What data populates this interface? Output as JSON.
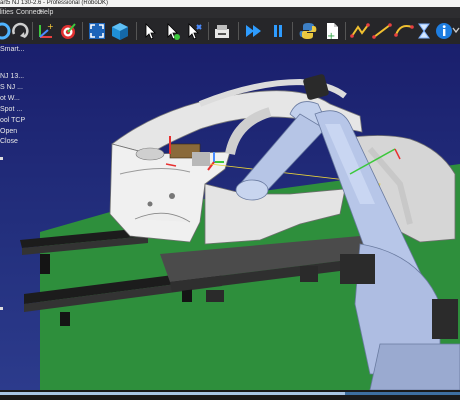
{
  "window": {
    "title": "art5 NJ 130-2.6 - Professional (RoboDK)"
  },
  "menu": {
    "items": [
      "ilities",
      "Connect",
      "Help"
    ]
  },
  "toolbar": {
    "buttons": [
      "refresh-icon",
      "redo-icon",
      "add-frame-icon",
      "add-target-icon",
      "fit-all-icon",
      "iso-view-icon",
      "select-icon",
      "move-icon",
      "move-tool-icon",
      "program-icon",
      "run-icon",
      "pause-icon",
      "python-icon",
      "add-file-icon",
      "linear-move-icon",
      "joint-move-icon",
      "circular-move-icon",
      "wait-icon",
      "info-icon",
      "more-icon"
    ]
  },
  "station_tree": {
    "items": [
      "Smart...",
      "NJ 13...",
      "S NJ ...",
      "ot W...",
      "Spot ...",
      "ool TCP",
      "Open",
      "Close"
    ]
  },
  "colors": {
    "floor": "#2e8f3c",
    "robot": "#b9c8e8",
    "car_body": "#d9d9d9",
    "toolbar_bg": "#262629",
    "viewport_bg": "#1f2672"
  },
  "simulation": {
    "progress": 0.75
  }
}
